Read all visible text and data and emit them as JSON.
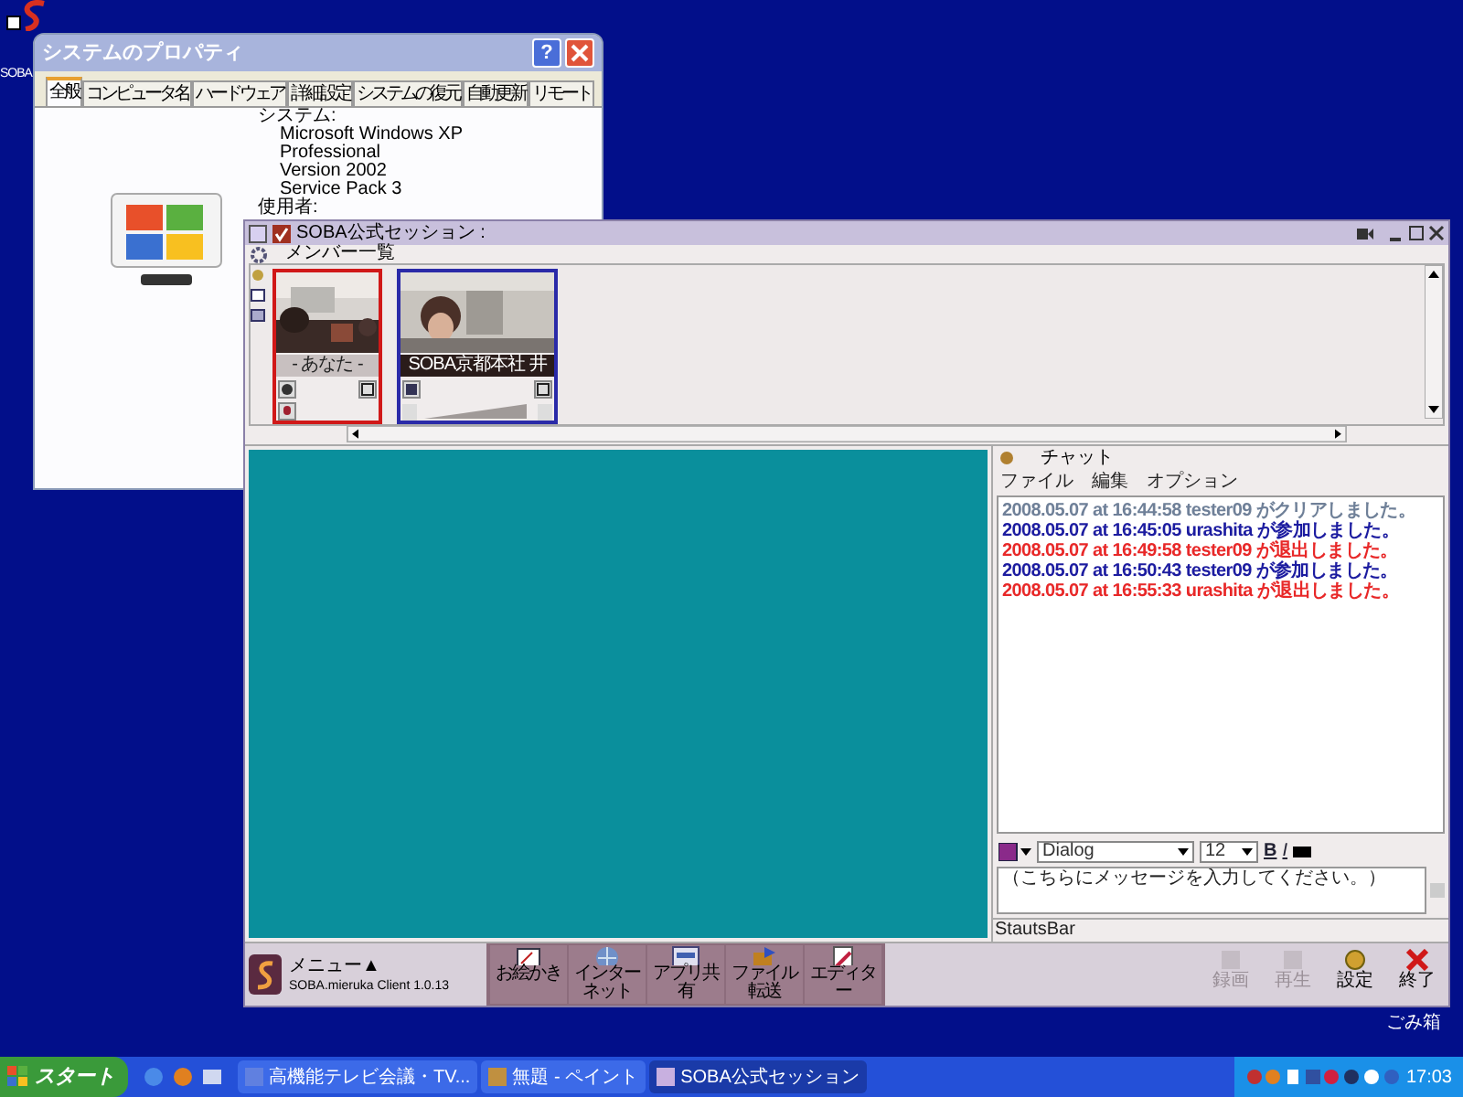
{
  "desktop_icons": [
    {
      "label": "SOBA"
    },
    {
      "label": "ごみ箱"
    }
  ],
  "system_properties": {
    "title": "システムのプロパティ",
    "help": "?",
    "tabs": [
      {
        "label": "全般",
        "selected": true
      },
      {
        "label": "コンピュータ名",
        "selected": false
      },
      {
        "label": "ハードウェア",
        "selected": false
      },
      {
        "label": "詳細設定",
        "selected": false
      },
      {
        "label": "システムの復元",
        "selected": false
      },
      {
        "label": "自動更新",
        "selected": false
      },
      {
        "label": "リモート",
        "selected": false
      }
    ],
    "heading": "システム:",
    "details": [
      "Microsoft Windows XP",
      "Professional",
      "Version 2002",
      "Service Pack 3"
    ],
    "user_heading": "使用者:"
  },
  "session": {
    "title": "SOBA公式セッション :",
    "members": {
      "title": "メンバー一覧",
      "cards": [
        {
          "name": "- あなた -",
          "color": "#d01818",
          "kind": "self"
        },
        {
          "name": "SOBA京都本社 井",
          "color": "#2a2aa8",
          "kind": "remote"
        }
      ]
    },
    "chat": {
      "title": "チャット",
      "menu": [
        "ファイル",
        "編集",
        "オプション"
      ],
      "messages": [
        {
          "text": "2008.05.07 at 16:44:58 tester09 がクリアしました。",
          "color": "#6f8098"
        },
        {
          "text": "2008.05.07 at 16:45:05 urashita が参加しました。",
          "color": "#1c1ca0"
        },
        {
          "text": "2008.05.07 at 16:49:58 tester09 が退出しました。",
          "color": "#e82828"
        },
        {
          "text": "2008.05.07 at 16:50:43 tester09 が参加しました。",
          "color": "#1c1ca0"
        },
        {
          "text": "2008.05.07 at 16:55:33 urashita が退出しました。",
          "color": "#e82828"
        }
      ],
      "font": "Dialog",
      "size": "12",
      "bold": "B",
      "italic": "I",
      "placeholder": "（こちらにメッセージを入力してください。）",
      "status": "StautsBar"
    },
    "toolbar": {
      "menu": "メニュー▲",
      "version": "SOBA.mieruka Client 1.0.13",
      "tools": [
        "お絵かき",
        "インターネット",
        "アプリ共有",
        "ファイル転送",
        "エディター"
      ],
      "actions": [
        {
          "label": "録画",
          "disabled": true
        },
        {
          "label": "再生",
          "disabled": true
        },
        {
          "label": "設定",
          "disabled": false
        },
        {
          "label": "終了",
          "disabled": false
        }
      ]
    }
  },
  "taskbar": {
    "start": "スタート",
    "tasks": [
      {
        "label": "高機能テレビ会議・TV...",
        "selected": false
      },
      {
        "label": "無題 - ペイント",
        "selected": false
      },
      {
        "label": "SOBA公式セッション",
        "selected": true
      }
    ],
    "clock": "17:03"
  }
}
